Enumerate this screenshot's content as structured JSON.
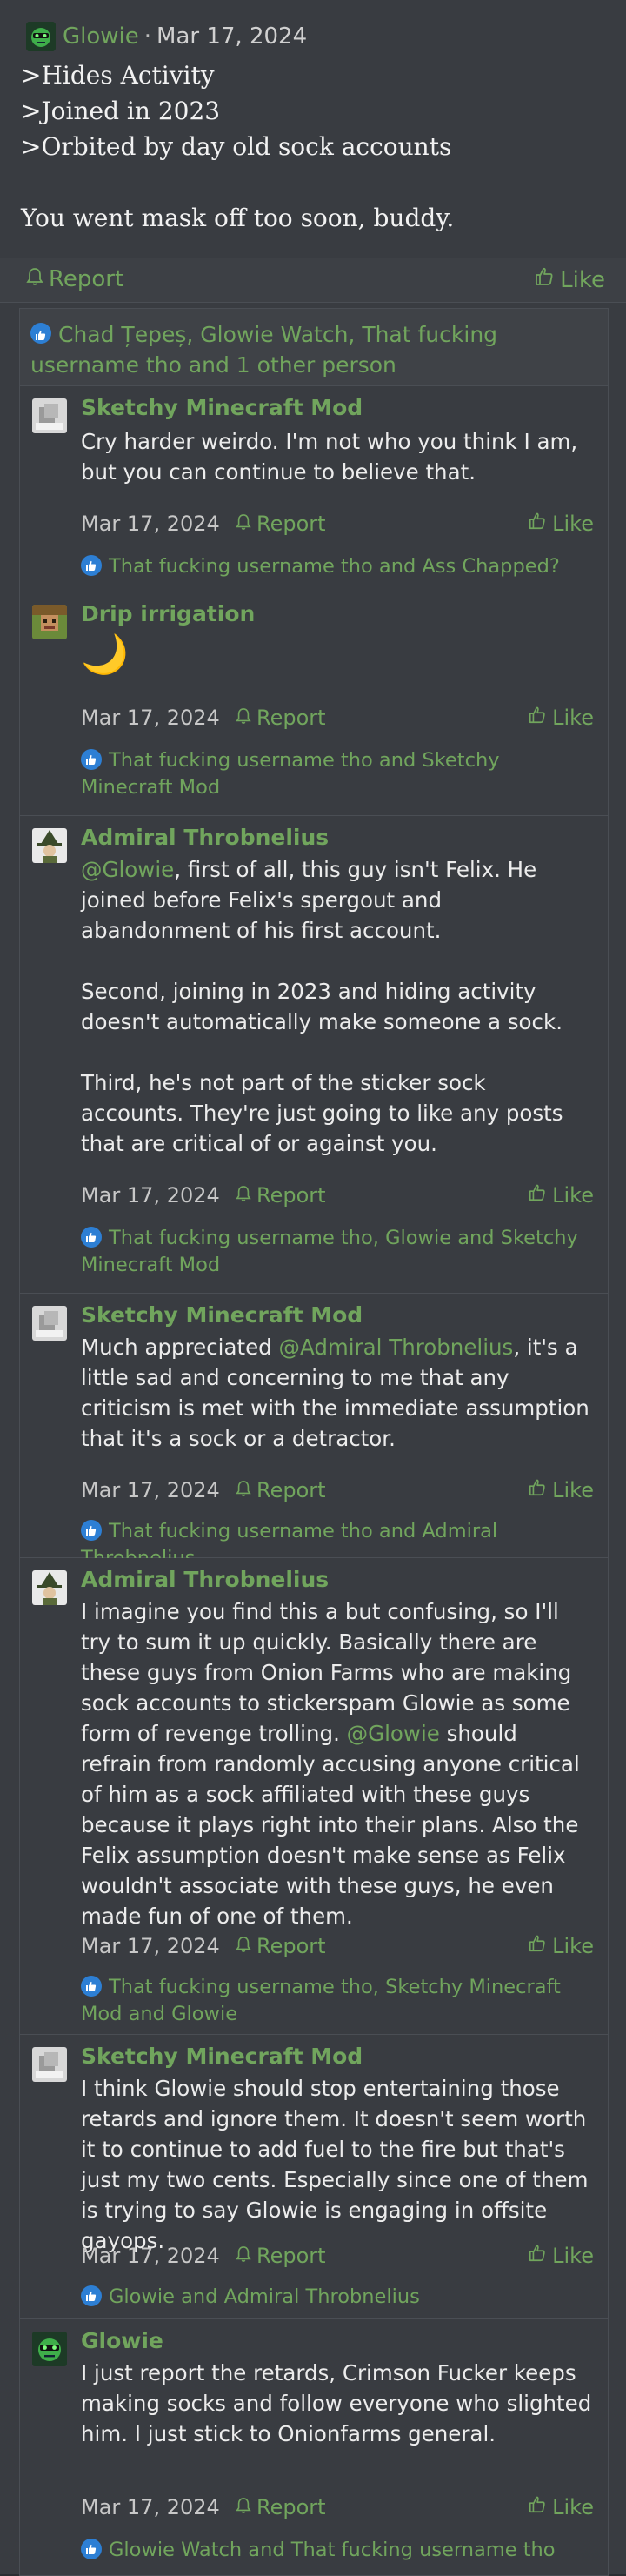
{
  "post": {
    "author": "Glowie",
    "separator": "·",
    "date": "Mar 17, 2024",
    "lines": [
      ">Hides Activity",
      ">Joined in 2023",
      ">Orbited by day old sock accounts",
      "",
      "You went mask off too soon, buddy."
    ],
    "report_label": "Report",
    "like_label": "Like"
  },
  "likers": "Chad Țepeș, Glowie Watch, That fucking username tho and 1 other person",
  "replies": [
    {
      "author": "Sketchy Minecraft Mod",
      "avatar_icon": "placeholder-avatar-icon",
      "paragraphs": [
        "Cry harder weirdo. I'm not who you think I am, but you can continue to believe that."
      ],
      "date": "Mar 17, 2024",
      "report_label": "Report",
      "like_label": "Like",
      "likes": "That fucking username tho and Ass Chapped?"
    },
    {
      "author": "Drip irrigation",
      "avatar_icon": "pixel-avatar-icon",
      "paragraphs": [
        "🌙"
      ],
      "date": "Mar 17, 2024",
      "report_label": "Report",
      "like_label": "Like",
      "likes": "That fucking username tho and Sketchy Minecraft Mod"
    },
    {
      "author": "Admiral Throbnelius",
      "avatar_icon": "witch-avatar-icon",
      "mention": "@Glowie",
      "paragraphs": [
        ", first of all, this guy isn't Felix. He joined before Felix's spergout and abandonment of his first account.",
        "Second, joining in 2023 and hiding activity doesn't automatically make someone a sock.",
        "Third, he's not part of the sticker sock accounts. They're just going to like any posts that are critical of or against you."
      ],
      "date": "Mar 17, 2024",
      "report_label": "Report",
      "like_label": "Like",
      "likes": "That fucking username tho, Glowie and Sketchy Minecraft Mod"
    },
    {
      "author": "Sketchy Minecraft Mod",
      "avatar_icon": "placeholder-avatar-icon",
      "prefix": "Much appreciated ",
      "mention": "@Admiral Throbnelius",
      "paragraphs": [
        ", it's a little sad and concerning to me that any criticism is met with the immediate assumption that it's a sock or a detractor."
      ],
      "date": "Mar 17, 2024",
      "report_label": "Report",
      "like_label": "Like",
      "likes": "That fucking username tho and Admiral Throbnelius"
    },
    {
      "author": "Admiral Throbnelius",
      "avatar_icon": "witch-avatar-icon",
      "prefix": "I imagine you find this a but confusing, so I'll try to sum it up quickly. Basically there are these guys from Onion Farms who are making sock accounts to stickerspam Glowie as some form of revenge trolling. ",
      "mention": "@Glowie",
      "paragraphs": [
        " should refrain from randomly accusing anyone critical of him as a sock affiliated with these guys because it plays right into their plans. Also the Felix assumption doesn't make sense as Felix wouldn't associate with these guys, he even made fun of one of them."
      ],
      "date": "Mar 17, 2024",
      "report_label": "Report",
      "like_label": "Like",
      "likes": "That fucking username tho, Sketchy Minecraft Mod and Glowie"
    },
    {
      "author": "Sketchy Minecraft Mod",
      "avatar_icon": "placeholder-avatar-icon",
      "paragraphs": [
        "I think Glowie should stop entertaining those retards and ignore them. It doesn't seem worth it to continue to add fuel to the fire but that's just my two cents. Especially since one of them is trying to say Glowie is engaging in offsite gayops."
      ],
      "date": "Mar 17, 2024",
      "report_label": "Report",
      "like_label": "Like",
      "likes": "Glowie and Admiral Throbnelius"
    },
    {
      "author": "Glowie",
      "avatar_icon": "glowie-avatar-icon",
      "paragraphs": [
        "I just report the retards, Crimson Fucker keeps making socks and follow everyone who slighted him. I just stick to Onionfarms general."
      ],
      "date": "Mar 17, 2024",
      "report_label": "Report",
      "like_label": "Like",
      "likes": "Glowie Watch and That fucking username tho"
    }
  ]
}
